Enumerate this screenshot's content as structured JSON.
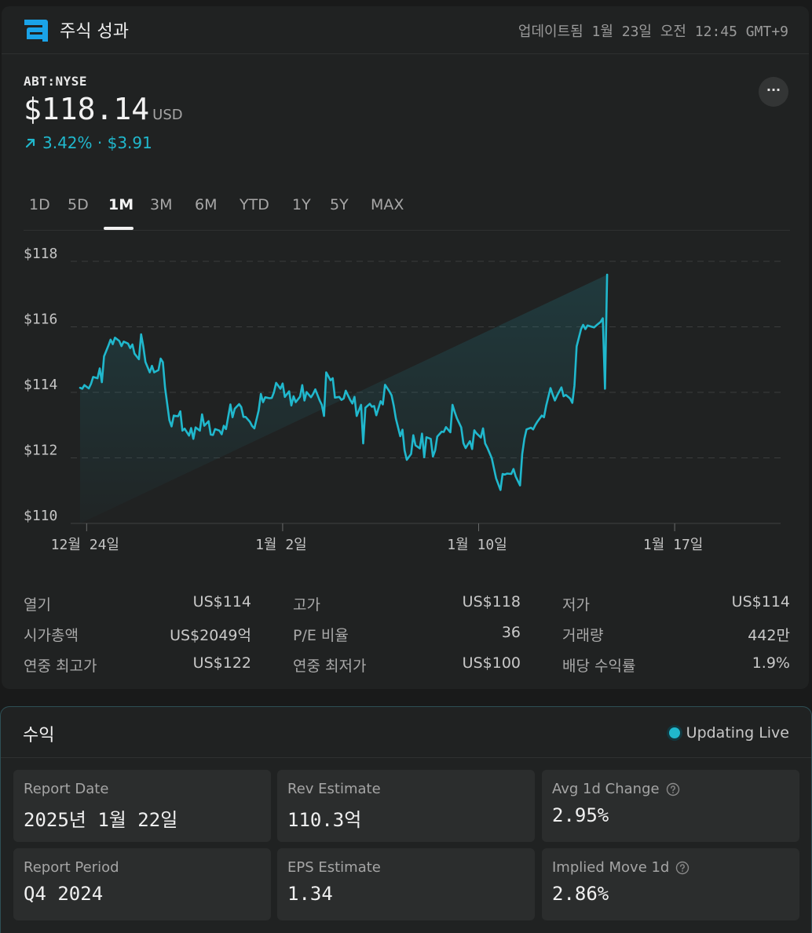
{
  "header": {
    "title": "주식 성과",
    "updated": "업데이트됨 1월 23일 오전 12:45 GMT+9"
  },
  "quote": {
    "ticker": "ABT:NYSE",
    "price": "$118.14",
    "currency": "USD",
    "change": "3.42% · $3.91",
    "more_label": "···"
  },
  "tabs": [
    "1D",
    "5D",
    "1M",
    "3M",
    "6M",
    "YTD",
    "1Y",
    "5Y",
    "MAX"
  ],
  "active_tab": "1M",
  "colors": {
    "accent": "#20b8cd",
    "background": "#202222",
    "gridline": "#3a3c3c"
  },
  "chart_data": {
    "type": "area",
    "y_ticks": [
      "$118",
      "$116",
      "$114",
      "$112",
      "$110"
    ],
    "ylim": [
      110,
      118
    ],
    "x_tick_labels": [
      "12월 24일",
      "1월 2일",
      "1월 10일",
      "1월 17일"
    ],
    "x_tick_positions": [
      0.3,
      9.3,
      18.3,
      27.3
    ],
    "xlim": [
      0,
      30
    ],
    "baseline": 114.14,
    "x": [
      0.0,
      0.1,
      0.2,
      0.4,
      0.5,
      0.6,
      0.8,
      0.9,
      1.0,
      1.1,
      1.3,
      1.4,
      1.5,
      1.6,
      1.8,
      1.9,
      2.0,
      2.2,
      2.3,
      2.4,
      2.5,
      2.7,
      2.8,
      2.9,
      3.0,
      3.2,
      3.3,
      3.4,
      3.6,
      3.7,
      3.8,
      3.9,
      4.1,
      4.2,
      4.3,
      4.5,
      4.6,
      4.7,
      4.8,
      5.0,
      5.1,
      5.2,
      5.3,
      5.5,
      5.6,
      5.7,
      5.9,
      6.0,
      6.1,
      6.2,
      6.4,
      6.5,
      6.6,
      6.7,
      6.9,
      7.0,
      7.1,
      7.3,
      7.4,
      7.5,
      7.6,
      7.8,
      7.9,
      8.0,
      8.2,
      8.3,
      8.4,
      8.5,
      8.7,
      8.8,
      8.9,
      9.0,
      9.2,
      9.3,
      9.4,
      9.6,
      9.7,
      9.8,
      9.9,
      10.1,
      10.2,
      10.3,
      10.4,
      10.6,
      10.7,
      10.8,
      11.0,
      11.1,
      11.2,
      11.3,
      11.5,
      11.6,
      11.7,
      11.9,
      12.0,
      12.1,
      12.2,
      12.4,
      12.5,
      12.6,
      12.7,
      12.9,
      13.0,
      13.1,
      13.3,
      13.4,
      13.5,
      13.6,
      13.8,
      13.9,
      14.0,
      14.2,
      14.3,
      14.4,
      14.5,
      14.7,
      14.8,
      14.9,
      15.0,
      15.2,
      15.3,
      15.4,
      15.6,
      15.7,
      15.8,
      15.9,
      16.1,
      16.2,
      16.3,
      16.4,
      16.6,
      16.7,
      16.8,
      17.0,
      17.1,
      17.2,
      17.3,
      17.5,
      17.6,
      17.7,
      17.9,
      18.0,
      18.1,
      18.2,
      18.4,
      18.5,
      18.6,
      18.7,
      18.9,
      19.0,
      19.1,
      19.3,
      19.4,
      19.5,
      19.6,
      19.8,
      19.9,
      20.0,
      20.2,
      20.3,
      20.4,
      20.5,
      20.7,
      20.8,
      20.9,
      21.0,
      21.2,
      21.3,
      21.4,
      21.6,
      21.7,
      21.8,
      21.9,
      22.1,
      22.2,
      22.3,
      22.5,
      22.6,
      22.7,
      22.8,
      23.0,
      23.1,
      23.2,
      23.3,
      23.5,
      23.6,
      23.7,
      23.9,
      24.0,
      24.1,
      24.2,
      24.4,
      24.5,
      24.6,
      24.8,
      24.9,
      25.0,
      25.1,
      25.3,
      25.4,
      25.5,
      25.6,
      25.8,
      25.9,
      26.0,
      26.2,
      26.3,
      26.4,
      26.5,
      26.7,
      26.8,
      26.9,
      27.1,
      27.2,
      27.3,
      27.4,
      27.6,
      27.7,
      27.8,
      28.0,
      28.1,
      28.2,
      28.3,
      28.5,
      28.6,
      28.7,
      28.8,
      29.0,
      29.1,
      29.2,
      29.4,
      29.5,
      29.6,
      29.7,
      29.9,
      30.0
    ],
    "values": [
      114.14,
      114.11,
      114.22,
      114.12,
      114.26,
      114.47,
      114.43,
      114.73,
      114.31,
      115.1,
      115.43,
      115.61,
      115.47,
      115.67,
      115.57,
      115.41,
      115.55,
      115.49,
      115.35,
      115.46,
      115.18,
      115.01,
      115.77,
      115.41,
      114.93,
      114.61,
      114.81,
      114.61,
      114.68,
      115.03,
      114.92,
      114.14,
      113.15,
      112.96,
      113.29,
      113.27,
      113.42,
      112.83,
      112.89,
      112.68,
      112.91,
      112.58,
      112.93,
      112.83,
      113.33,
      112.98,
      113.12,
      112.71,
      112.7,
      112.88,
      112.83,
      112.72,
      112.98,
      112.88,
      113.63,
      113.24,
      113.5,
      113.64,
      113.55,
      113.25,
      113.25,
      113.1,
      112.97,
      112.9,
      113.45,
      113.95,
      113.7,
      113.85,
      113.82,
      113.83,
      114.0,
      114.29,
      114.11,
      114.27,
      113.86,
      114.03,
      113.6,
      113.88,
      113.7,
      113.87,
      114.22,
      113.75,
      114.01,
      113.85,
      113.95,
      114.09,
      113.75,
      113.62,
      113.28,
      114.61,
      114.37,
      114.43,
      113.84,
      113.86,
      113.77,
      113.81,
      114.05,
      113.77,
      113.66,
      113.86,
      113.28,
      113.62,
      112.44,
      113.53,
      113.65,
      113.56,
      113.58,
      113.3,
      113.73,
      113.63,
      114.23,
      114.03,
      113.91,
      113.59,
      113.2,
      112.66,
      112.86,
      112.23,
      111.94,
      112.12,
      112.69,
      112.38,
      112.29,
      112.74,
      112.02,
      112.63,
      112.58,
      112.04,
      112.23,
      112.65,
      112.8,
      112.79,
      112.94,
      112.78,
      113.62,
      113.4,
      113.21,
      112.93,
      112.45,
      112.3,
      112.51,
      112.27,
      112.84,
      112.75,
      112.62,
      112.9,
      112.44,
      112.31,
      111.99,
      111.69,
      111.38,
      111.02,
      111.51,
      111.49,
      111.52,
      111.51,
      111.66,
      111.43,
      111.16,
      112.12,
      112.59,
      112.87,
      112.92,
      112.87,
      113.0,
      113.11,
      113.29,
      113.24,
      113.59,
      114.13,
      113.93,
      113.75,
      113.9,
      114.15,
      113.88,
      113.92,
      113.81,
      113.68,
      114.2,
      115.4,
      115.93,
      116.06,
      115.93,
      116.04,
      116.0,
      115.98,
      116.04,
      116.15,
      116.26,
      114.11,
      117.59
    ]
  },
  "stats": [
    {
      "label": "열기",
      "value": "US$114"
    },
    {
      "label": "고가",
      "value": "US$118"
    },
    {
      "label": "저가",
      "value": "US$114"
    },
    {
      "label": "시가총액",
      "value": "US$2049억"
    },
    {
      "label": "P/E 비율",
      "value": "36"
    },
    {
      "label": "거래량",
      "value": "442만"
    },
    {
      "label": "연중 최고가",
      "value": "US$122"
    },
    {
      "label": "연중 최저가",
      "value": "US$100"
    },
    {
      "label": "배당 수익률",
      "value": "1.9%"
    }
  ],
  "earnings": {
    "title": "수익",
    "live_label": "Updating Live",
    "cells": [
      {
        "label": "Report Date",
        "value": "2025년 1월 22일",
        "help": false
      },
      {
        "label": "Rev Estimate",
        "value": "110.3억",
        "help": false
      },
      {
        "label": "Avg 1d Change",
        "value": "2.95%",
        "help": true
      },
      {
        "label": "Report Period",
        "value": "Q4 2024",
        "help": false
      },
      {
        "label": "EPS Estimate",
        "value": "1.34",
        "help": false
      },
      {
        "label": "Implied Move 1d",
        "value": "2.86%",
        "help": true
      }
    ]
  }
}
